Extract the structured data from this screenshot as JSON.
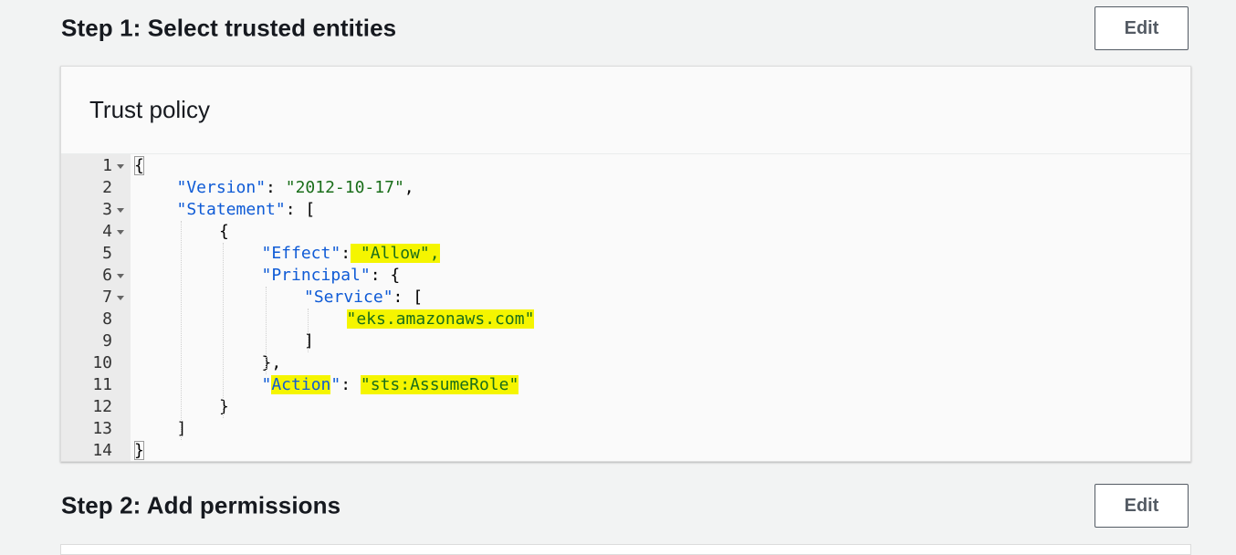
{
  "step1": {
    "title": "Step 1: Select trusted entities",
    "edit_label": "Edit"
  },
  "trust_policy": {
    "title": "Trust policy",
    "lines": [
      {
        "num": "1",
        "fold": true,
        "indent": 0,
        "segments": [
          {
            "t": "{",
            "c": "punc",
            "box": true
          }
        ]
      },
      {
        "num": "2",
        "fold": false,
        "indent": 1,
        "segments": [
          {
            "t": "\"Version\"",
            "c": "key"
          },
          {
            "t": ": ",
            "c": "punc"
          },
          {
            "t": "\"2012-10-17\"",
            "c": "str"
          },
          {
            "t": ",",
            "c": "punc"
          }
        ]
      },
      {
        "num": "3",
        "fold": true,
        "indent": 1,
        "segments": [
          {
            "t": "\"Statement\"",
            "c": "key"
          },
          {
            "t": ": [",
            "c": "punc"
          }
        ]
      },
      {
        "num": "4",
        "fold": true,
        "indent": 2,
        "segments": [
          {
            "t": "{",
            "c": "punc"
          }
        ]
      },
      {
        "num": "5",
        "fold": false,
        "indent": 3,
        "segments": [
          {
            "t": "\"Effect\"",
            "c": "key"
          },
          {
            "t": ":",
            "c": "punc"
          },
          {
            "t": " \"Allow\",",
            "c": "str",
            "hl": true
          }
        ]
      },
      {
        "num": "6",
        "fold": true,
        "indent": 3,
        "segments": [
          {
            "t": "\"Principal\"",
            "c": "key"
          },
          {
            "t": ": {",
            "c": "punc"
          }
        ]
      },
      {
        "num": "7",
        "fold": true,
        "indent": 4,
        "segments": [
          {
            "t": "\"Service\"",
            "c": "key"
          },
          {
            "t": ": [",
            "c": "punc"
          }
        ]
      },
      {
        "num": "8",
        "fold": false,
        "indent": 5,
        "segments": [
          {
            "t": "\"eks.amazonaws.com\"",
            "c": "str",
            "hl": true
          }
        ]
      },
      {
        "num": "9",
        "fold": false,
        "indent": 4,
        "segments": [
          {
            "t": "]",
            "c": "punc"
          }
        ]
      },
      {
        "num": "10",
        "fold": false,
        "indent": 3,
        "segments": [
          {
            "t": "},",
            "c": "punc"
          }
        ]
      },
      {
        "num": "11",
        "fold": false,
        "indent": 3,
        "segments": [
          {
            "t": "\"",
            "c": "key"
          },
          {
            "t": "Action",
            "c": "key",
            "hl": true
          },
          {
            "t": "\"",
            "c": "key"
          },
          {
            "t": ": ",
            "c": "punc"
          },
          {
            "t": "\"sts:AssumeRole\"",
            "c": "str",
            "hl": true
          }
        ]
      },
      {
        "num": "12",
        "fold": false,
        "indent": 2,
        "segments": [
          {
            "t": "}",
            "c": "punc"
          }
        ]
      },
      {
        "num": "13",
        "fold": false,
        "indent": 1,
        "segments": [
          {
            "t": "]",
            "c": "punc"
          }
        ]
      },
      {
        "num": "14",
        "fold": false,
        "indent": 0,
        "segments": [
          {
            "t": "}",
            "c": "punc",
            "box": true
          }
        ]
      }
    ]
  },
  "step2": {
    "title": "Step 2: Add permissions",
    "edit_label": "Edit"
  },
  "colors": {
    "highlight": "#f5f500",
    "key": "#0f5bd6",
    "string": "#1a6e1a",
    "background": "#f2f3f3"
  }
}
